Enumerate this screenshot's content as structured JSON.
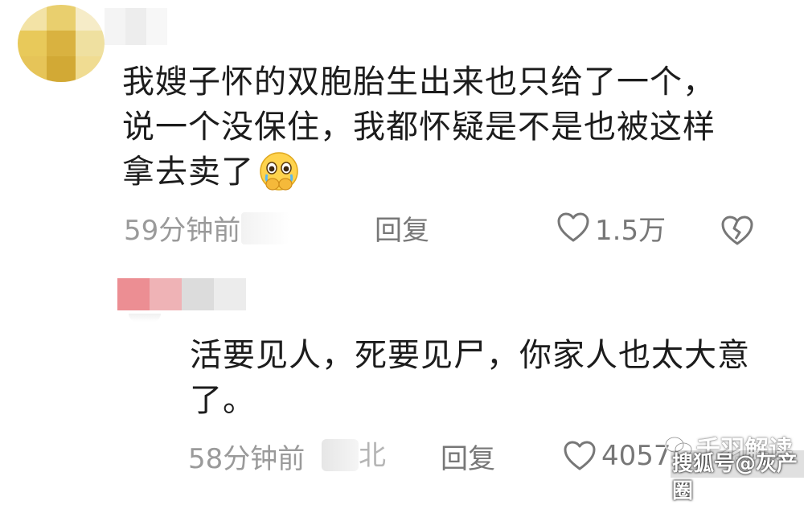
{
  "comments": [
    {
      "text_lines": [
        "我嫂子怀的双胞胎生出来也只给了一个，",
        "说一个没保住，我都怀疑是不是也被这样",
        "拿去卖了"
      ],
      "emoji": "crying-face-hands-icon",
      "time": "59分钟前",
      "reply_label": "回复",
      "like_count": "1.5万"
    },
    {
      "text_lines": [
        "活要见人，死要见尸，你家人也太大意",
        "了。"
      ],
      "time": "58分钟前",
      "ip_partial": "北",
      "reply_label": "回复",
      "like_count": "4057"
    }
  ],
  "watermarks": {
    "wechat_account": "千羽解读",
    "sohu": "搜狐号@灰产圈"
  },
  "colors": {
    "text": "#1c1c1c",
    "meta": "#9a9a9a",
    "action": "#777777"
  }
}
